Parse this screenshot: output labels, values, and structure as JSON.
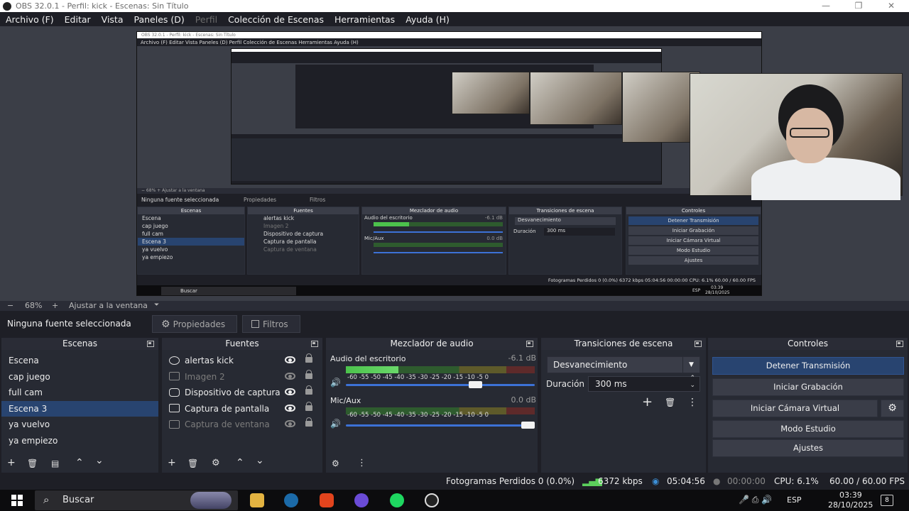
{
  "window": {
    "title": "OBS 32.0.1 - Perfil: kick - Escenas: Sin Título",
    "minimize": "—",
    "maximize": "❐",
    "close": "✕"
  },
  "menu": [
    "Archivo (F)",
    "Editar",
    "Vista",
    "Paneles (D)",
    "Perfil",
    "Colección de Escenas",
    "Herramientas",
    "Ayuda (H)"
  ],
  "zoom": {
    "minus": "−",
    "value": "68%",
    "plus": "+",
    "fit": "Ajustar a la ventana",
    "toggle": "⏷"
  },
  "properties_bar": {
    "no_source": "Ninguna fuente seleccionada",
    "properties": "Propiedades",
    "filters": "Filtros"
  },
  "scenes": {
    "title": "Escenas",
    "items": [
      "Escena",
      "cap juego",
      "full cam",
      "Escena 3",
      "ya vuelvo",
      "ya empiezo"
    ],
    "selected": "Escena 3"
  },
  "sources": {
    "title": "Fuentes",
    "items": [
      {
        "name": "alertas kick",
        "icon": "browser-icon",
        "visible": true
      },
      {
        "name": "Imagen 2",
        "icon": "image-icon",
        "visible": false
      },
      {
        "name": "Dispositivo de captura",
        "icon": "camera-icon",
        "visible": true
      },
      {
        "name": "Captura de pantalla",
        "icon": "monitor-icon",
        "visible": true
      },
      {
        "name": "Captura de ventana",
        "icon": "window-icon",
        "visible": false
      }
    ]
  },
  "mixer": {
    "title": "Mezclador de audio",
    "ticks": "-60  -55  -50  -45  -40  -35  -30  -25  -20  -15  -10   -5    0",
    "channels": [
      {
        "name": "Audio del escritorio",
        "db": "-6.1 dB",
        "level": 0.28,
        "volume": 0.72
      },
      {
        "name": "Mic/Aux",
        "db": "0.0 dB",
        "level": 0.0,
        "volume": 1.0
      }
    ]
  },
  "transitions": {
    "title": "Transiciones de escena",
    "type": "Desvanecimiento",
    "duration_label": "Duración",
    "duration": "300 ms"
  },
  "controls": {
    "title": "Controles",
    "buttons": [
      "Detener Transmisión",
      "Iniciar Grabación",
      "Iniciar Cámara Virtual",
      "Modo Estudio",
      "Ajustes"
    ]
  },
  "status": {
    "dropped": "Fotogramas Perdidos 0 (0.0%)",
    "bitrate": "6372 kbps",
    "stream_time": "05:04:56",
    "rec_time": "00:00:00",
    "cpu": "CPU: 6.1%",
    "fps": "60.00 / 60.00 FPS"
  },
  "taskbar": {
    "search": "Buscar",
    "lang": "ESP",
    "time": "03:39",
    "date": "28/10/2025",
    "notifications": "8"
  },
  "nested": {
    "title": "OBS 32.0.1 - Perfil: kick - Escenas: Sin Título",
    "menu": "Archivo (F)   Editar   Vista   Paneles (D)   Perfil   Colección de Escenas   Herramientas   Ayuda (H)",
    "zoom": "−   68%   +   Ajustar a la ventana",
    "no_source": "Ninguna fuente seleccionada",
    "props": "Propiedades",
    "filters": "Filtros",
    "scenes_h": "Escenas",
    "sources_h": "Fuentes",
    "mixer_h": "Mezclador de audio",
    "trans_h": "Transiciones de escena",
    "controls_h": "Controles",
    "scenes": [
      "Escena",
      "cap juego",
      "full cam",
      "Escena 3",
      "ya vuelvo",
      "ya empiezo"
    ],
    "sources": [
      "alertas kick",
      "Imagen 2",
      "Dispositivo de captura",
      "Captura de pantalla",
      "Captura de ventana"
    ],
    "ch1": "Audio del escritorio",
    "ch1db": "-6.1 dB",
    "ch2": "Mic/Aux",
    "ch2db": "0.0 dB",
    "trans": "Desvanecimiento",
    "dur_label": "Duración",
    "dur": "300 ms",
    "controls": [
      "Detener Transmisión",
      "Iniciar Grabación",
      "Iniciar Cámara Virtual",
      "Modo Estudio",
      "Ajustes"
    ],
    "status": "Fotogramas Perdidos 0 (0.0%)     6372 kbps     05:04:56     00:00:00     CPU: 6.1%     60.00 / 60.00 FPS",
    "search": "Buscar",
    "lang": "ESP",
    "time": "03:39",
    "date": "28/10/2025"
  },
  "colors": {
    "accent": "#284470",
    "meter_green": "#4cc24c",
    "slider": "#3c71d6"
  }
}
